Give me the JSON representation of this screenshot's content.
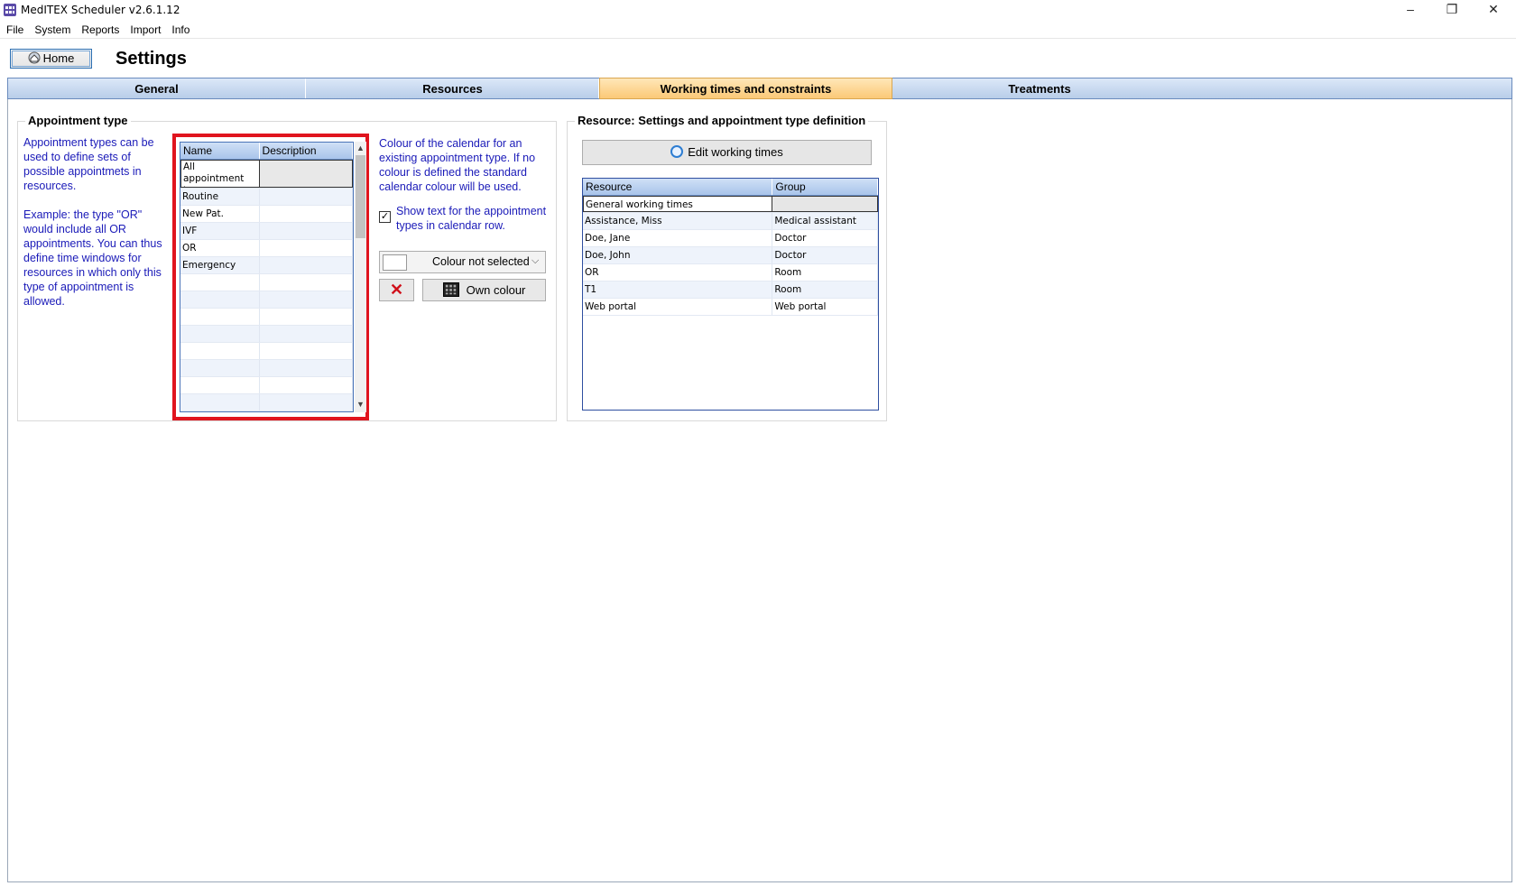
{
  "window": {
    "title": "MedITEX Scheduler  v2.6.1.12",
    "controls": {
      "minimize": "–",
      "maximize": "❐",
      "close": "✕"
    }
  },
  "menu": [
    "File",
    "System",
    "Reports",
    "Import",
    "Info"
  ],
  "header": {
    "home_label": "Home",
    "page_title": "Settings"
  },
  "tabs": [
    {
      "label": "General",
      "active": false
    },
    {
      "label": "Resources",
      "active": false
    },
    {
      "label": "Working times and constraints",
      "active": true
    },
    {
      "label": "Treatments",
      "active": false
    }
  ],
  "appointment_type": {
    "title": "Appointment type",
    "description_1": "Appointment types can be used to define sets of possible appointmets in resources.",
    "description_2": "Example: the type \"OR\" would include all OR appointments. You can thus define time windows for resources in which only this type of appointment is allowed.",
    "table": {
      "columns": [
        "Name",
        "Description"
      ],
      "rows": [
        {
          "name": "All appointment types",
          "description": ""
        },
        {
          "name": "Routine",
          "description": ""
        },
        {
          "name": "New Pat.",
          "description": ""
        },
        {
          "name": "IVF",
          "description": ""
        },
        {
          "name": "OR",
          "description": ""
        },
        {
          "name": "Emergency",
          "description": ""
        }
      ]
    },
    "colour_description": "Colour of the calendar for an existing appointment type. If no colour is defined the standard calendar colour will be used.",
    "show_text_checked": true,
    "show_text_check_glyph": "✓",
    "show_text_label": "Show text for the appointment types in calendar row.",
    "colour_select_value": "Colour not selected",
    "colour_select_chevron": "⌵",
    "clear_colour_glyph": "✕",
    "own_colour_label": "Own colour"
  },
  "resource_settings": {
    "title": "Resource: Settings and appointment type definition",
    "edit_button_label": "Edit working times",
    "table": {
      "columns": [
        "Resource",
        "Group"
      ],
      "rows": [
        {
          "resource": "General working times",
          "group": ""
        },
        {
          "resource": "Assistance, Miss",
          "group": "Medical assistant"
        },
        {
          "resource": "Doe, Jane",
          "group": "Doctor"
        },
        {
          "resource": "Doe, John",
          "group": "Doctor"
        },
        {
          "resource": "OR",
          "group": "Room"
        },
        {
          "resource": "T1",
          "group": "Room"
        },
        {
          "resource": "Web portal",
          "group": "Web portal"
        }
      ]
    }
  },
  "scrollbar": {
    "up": "▲",
    "down": "▼"
  },
  "colors": {
    "active_tab": "#fbc977",
    "tab_bar": "#b8cde9",
    "highlight_border": "#e0141e",
    "help_text": "#1a1ab8"
  }
}
